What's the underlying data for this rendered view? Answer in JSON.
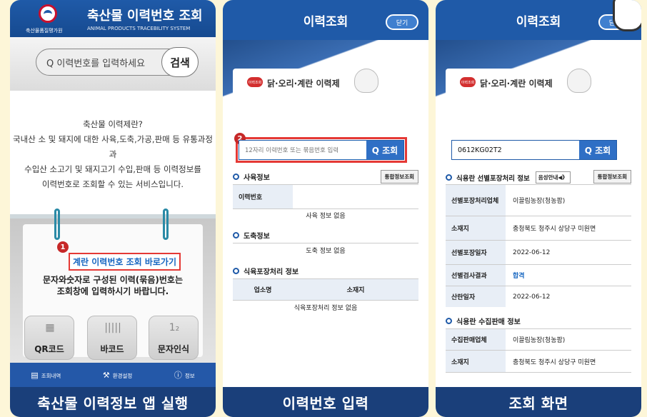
{
  "panel1": {
    "title": "축산물 이력번호 조회",
    "org": "축산물품질평가원",
    "eng": "ANIMAL PRODUCTS TRACEBILITY SYSTEM",
    "search_placeholder": "Q 이력번호를 입력하세요",
    "search_btn": "검색",
    "desc": [
      "축산물 이력제란?",
      "국내산 소 및 돼지에 대한 사육,도축,가공,판매 등 유통과정과",
      "수입산 소고기 및 돼지고기 수입,판매 등 이력정보를",
      "이력번호로 조회할 수 있는 서비스입니다."
    ],
    "step": "1",
    "link": "계란 이력번호 조회 바로가기",
    "note": [
      "문자와숫자로 구성된 이력(묶음)번호는",
      "조회창에 입력하시기 바랍니다."
    ],
    "tiles": [
      "QR코드",
      "바코드",
      "문자인식"
    ],
    "nav": [
      "조회내역",
      "환경설정",
      "정보"
    ],
    "caption": "축산물 이력정보 앱 실행"
  },
  "panel2": {
    "title": "이력조회",
    "close": "닫기",
    "logo": "이력조회",
    "banner": "닭·오리·계란 이력제",
    "step": "2",
    "placeholder": "12자리 이력번호 또는 묶음번호 입력",
    "search_btn": "Q 조회",
    "s1": "사육정보",
    "s1_btn": "통합정보조회",
    "s1_key": "이력번호",
    "s1_empty": "사육 정보 없음",
    "s2": "도축정보",
    "s2_empty": "도축 정보 없음",
    "s3": "식육포장처리 정보",
    "s3_col1": "업소명",
    "s3_col2": "소재지",
    "s3_empty": "식육포장처리 정보 없음",
    "caption": "이력번호 입력"
  },
  "panel3": {
    "title": "이력조회",
    "close": "닫기",
    "logo": "이력조회",
    "banner": "닭·오리·계란 이력제",
    "value": "0612KG02T2",
    "search_btn": "Q 조회",
    "s1": "식용란 선별포장처리 정보",
    "voice": "음성안내◀》",
    "s1_btn": "통합정보조회",
    "rows1": [
      [
        "선별포장처리업체",
        "이끌림농장(청농팜)"
      ],
      [
        "소재지",
        "충청북도 청주시 상당구 미원면"
      ],
      [
        "선별포장일자",
        "2022-06-12"
      ],
      [
        "선별검사결과",
        "합격"
      ],
      [
        "산란일자",
        "2022-06-12"
      ]
    ],
    "s2": "식용란 수집판매 정보",
    "rows2": [
      [
        "수집판매업체",
        "이끌림농장(청농팜)"
      ],
      [
        "소재지",
        "충청북도 청주시 상당구 미원면"
      ]
    ],
    "caption": "조회 화면"
  }
}
